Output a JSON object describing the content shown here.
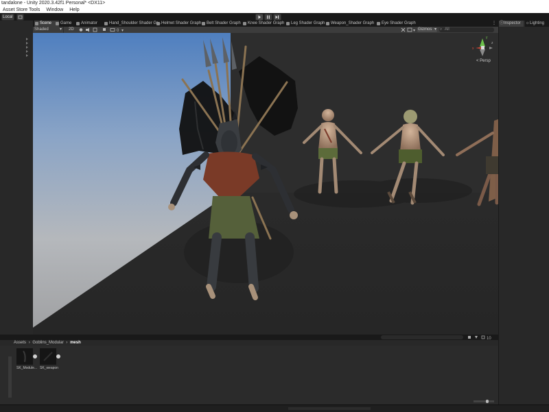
{
  "window": {
    "title": "tandalone - Unity 2020.3.42f1 Personal* <DX11>"
  },
  "menu": {
    "items": [
      "Asset Store Tools",
      "Window",
      "Help"
    ]
  },
  "toolbar": {
    "local_label": "Local",
    "play_icon": "play-icon",
    "pause_icon": "pause-icon",
    "step_icon": "step-icon"
  },
  "tabs": [
    {
      "label": "Scene",
      "active": true
    },
    {
      "label": "Game",
      "active": false
    },
    {
      "label": "Animator",
      "active": false
    },
    {
      "label": "Hand_Shoulder Shader Gr...",
      "active": false
    },
    {
      "label": "Helmet Shader Graph",
      "active": false
    },
    {
      "label": "Belt Shader Graph",
      "active": false
    },
    {
      "label": "Knee Shader Graph",
      "active": false
    },
    {
      "label": "Leg Shader Graph",
      "active": false
    },
    {
      "label": "Weapon_Shader Graph",
      "active": false
    },
    {
      "label": "Eye Shader Graph",
      "active": false
    }
  ],
  "scene_toolbar": {
    "shading_mode": "Shaded",
    "mode_2d": "2D",
    "gizmos": "Gizmos",
    "search_placeholder": "All"
  },
  "scene_gizmo": {
    "projection": "< Persp",
    "axis_x": "x",
    "axis_y": "y",
    "axis_z": "z"
  },
  "right_panel": {
    "tabs": [
      "Inspector",
      "Lighting"
    ]
  },
  "project": {
    "breadcrumb": [
      "Assets",
      "Goblins_Modular",
      "mesh"
    ],
    "assets": [
      {
        "label": "SK_Module..."
      },
      {
        "label": "SK_weapon"
      }
    ],
    "count_badge": "10"
  },
  "colors": {
    "editor_bg": "#282828",
    "toolbar_bg": "#191919",
    "active_tab": "#3c3c3c",
    "sky_top": "#5a86c0",
    "ground": "#2d2d2d"
  }
}
